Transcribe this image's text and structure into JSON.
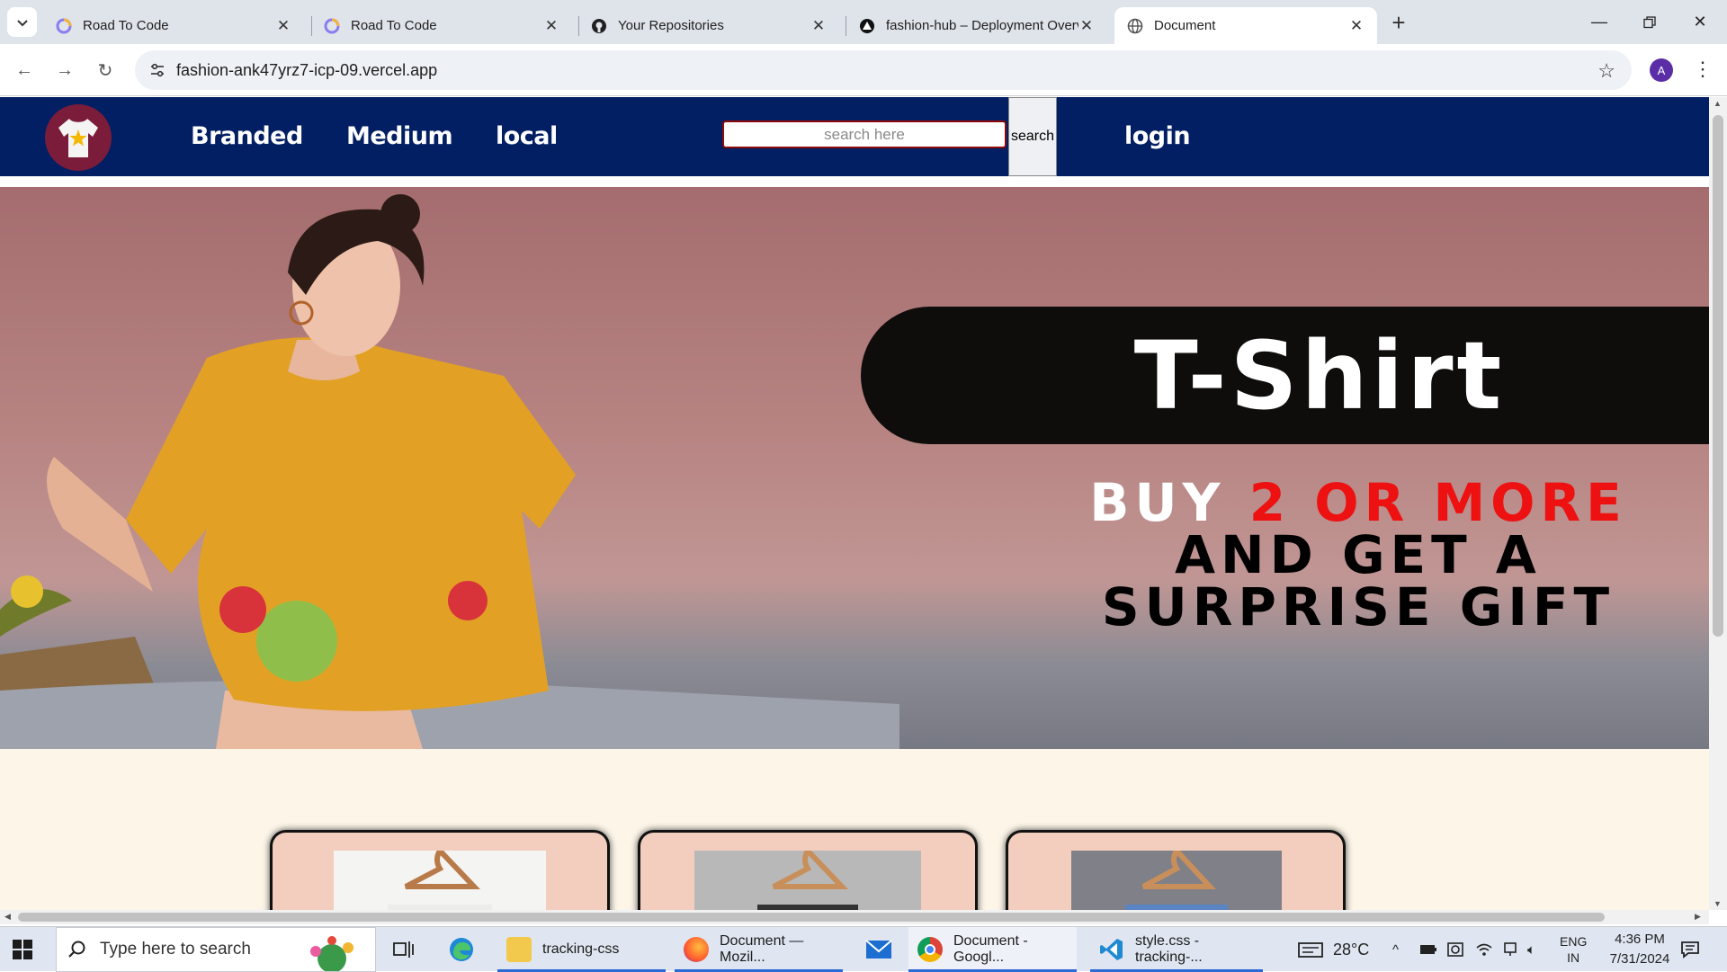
{
  "browser": {
    "tabs": [
      {
        "title": "Road To Code",
        "icon": "road-to-code-icon",
        "active": false
      },
      {
        "title": "Road To Code",
        "icon": "road-to-code-icon",
        "active": false
      },
      {
        "title": "Your Repositories",
        "icon": "github-icon",
        "active": false
      },
      {
        "title": "fashion-hub – Deployment Overview",
        "icon": "vercel-icon",
        "active": false
      },
      {
        "title": "Document",
        "icon": "globe-icon",
        "active": true
      }
    ],
    "url": "fashion-ank47yrz7-icp-09.vercel.app",
    "profile_initial": "A"
  },
  "site": {
    "nav": {
      "links": [
        "Branded",
        "Medium",
        "local"
      ],
      "search_placeholder": "search here",
      "search_button": "search",
      "login": "login"
    },
    "banner": {
      "headline": "T-Shirt",
      "promo_line1_white": "BUY ",
      "promo_line1_red": "2 OR MORE",
      "promo_line2": "AND GET A",
      "promo_line3": "SURPRISE GIFT"
    },
    "colors": {
      "nav_bg": "#021f64",
      "page_bg": "#fdf6e8",
      "promo_red": "#ee1111",
      "card_bg": "#f3cdbd"
    }
  },
  "taskbar": {
    "search_placeholder": "Type here to search",
    "apps": [
      {
        "label": "tracking-css",
        "icon": "folder-icon"
      },
      {
        "label": "Document — Mozil...",
        "icon": "firefox-icon"
      },
      {
        "label": "Document - Googl...",
        "icon": "chrome-icon"
      },
      {
        "label": "style.css - tracking-...",
        "icon": "vscode-icon"
      }
    ],
    "weather": "28°C",
    "lang_line1": "ENG",
    "lang_line2": "IN",
    "time": "4:36 PM",
    "date": "7/31/2024"
  }
}
